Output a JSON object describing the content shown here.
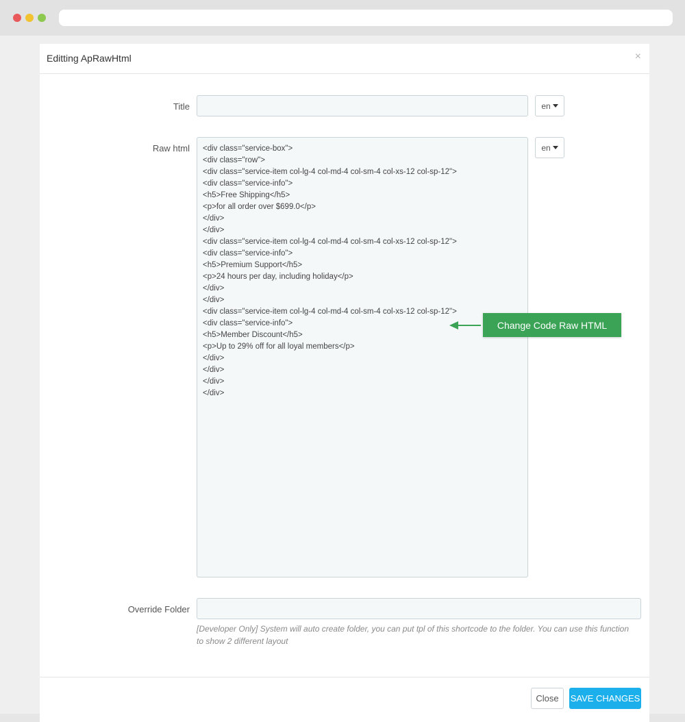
{
  "modal": {
    "title": "Editting ApRawHtml",
    "close_symbol": "×"
  },
  "form": {
    "title_label": "Title",
    "title_value": "",
    "title_lang": "en",
    "raw_label": "Raw html",
    "raw_lang": "en",
    "raw_lines": [
      "<div class=\"service-box\">",
      "<div class=\"row\">",
      "<div class=\"service-item col-lg-4 col-md-4 col-sm-4 col-xs-12 col-sp-12\">",
      "<div class=\"service-info\">",
      "<h5>Free Shipping</h5>",
      "<p>for all order over $699.0</p>",
      "</div>",
      "</div>",
      "<div class=\"service-item col-lg-4 col-md-4 col-sm-4 col-xs-12 col-sp-12\">",
      "<div class=\"service-info\">",
      "<h5>Premium Support</h5>",
      "<p>24 hours per day, including holiday</p>",
      "</div>",
      "</div>",
      "<div class=\"service-item col-lg-4 col-md-4 col-sm-4 col-xs-12 col-sp-12\">",
      "<div class=\"service-info\">",
      "<h5>Member Discount</h5>",
      "<p>Up to 29% off for all loyal members</p>",
      "</div>",
      "</div>",
      "</div>",
      "</div>"
    ],
    "override_label": "Override Folder",
    "override_value": "",
    "override_help": "[Developer Only] System will auto create folder, you can put tpl of this shortcode to the folder. You can use this function to show 2 different layout"
  },
  "footer": {
    "close_label": "Close",
    "save_label": "SAVE CHANGES"
  },
  "callout": {
    "text": "Change Code Raw HTML"
  },
  "colors": {
    "save_button": "#1bb0eb",
    "callout": "#3aa356",
    "field_bg": "#f5f8f9"
  }
}
